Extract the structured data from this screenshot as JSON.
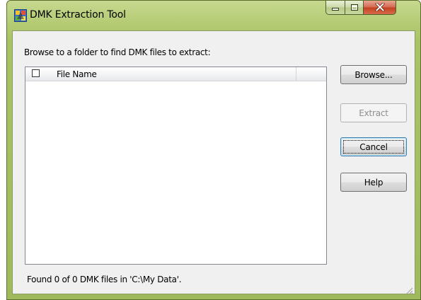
{
  "window": {
    "title": "DMK Extraction Tool",
    "app_icon": "dmk-app-icon",
    "controls": {
      "minimize": "minimize-icon",
      "maximize": "maximize-icon",
      "close": "close-icon"
    }
  },
  "main": {
    "instruction": "Browse to a folder to find DMK files to extract:",
    "file_list": {
      "columns": [
        {
          "label": "File Name",
          "has_checkbox": true,
          "checked": false
        },
        {
          "label": ""
        }
      ],
      "rows": []
    },
    "status": "Found 0 of 0 DMK files in 'C:\\My Data'."
  },
  "buttons": {
    "browse": {
      "label": "Browse...",
      "enabled": true
    },
    "extract": {
      "label": "Extract",
      "enabled": false
    },
    "cancel": {
      "label": "Cancel",
      "enabled": true,
      "default": true
    },
    "help": {
      "label": "Help",
      "enabled": true
    }
  },
  "colors": {
    "frame_accent": "#b3ca72",
    "close_button": "#c2401f",
    "client_bg": "#f0f0f0",
    "disabled_text": "#8d8d8d"
  }
}
